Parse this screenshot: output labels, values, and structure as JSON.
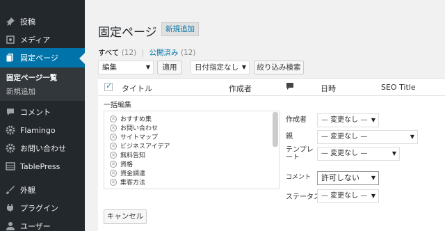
{
  "sidebar": {
    "items": [
      {
        "label": "投稿",
        "icon": "pin-icon"
      },
      {
        "label": "メディア",
        "icon": "media-icon"
      },
      {
        "label": "固定ページ",
        "icon": "pages-icon"
      },
      {
        "label": "コメント",
        "icon": "comment-icon"
      },
      {
        "label": "Flamingo",
        "icon": "gear-icon"
      },
      {
        "label": "お問い合わせ",
        "icon": "gear-icon"
      },
      {
        "label": "TablePress",
        "icon": "table-icon"
      },
      {
        "label": "外観",
        "icon": "brush-icon"
      },
      {
        "label": "プラグイン",
        "icon": "plugin-icon"
      },
      {
        "label": "ユーザー",
        "icon": "user-icon"
      }
    ],
    "submenu": [
      {
        "label": "固定ページ一覧"
      },
      {
        "label": "新規追加"
      }
    ]
  },
  "header": {
    "title": "固定ページ",
    "add_new": "新規追加"
  },
  "filters": {
    "all_label": "すべて",
    "all_count": "(12)",
    "sep": "|",
    "published_label": "公開済み",
    "published_count": "(12)"
  },
  "toolbar": {
    "bulk_action": "編集",
    "apply": "適用",
    "date_filter": "日付指定なし",
    "filter_button": "絞り込み検索"
  },
  "table": {
    "columns": [
      "タイトル",
      "作成者",
      "日時",
      "SEO Title"
    ]
  },
  "bulk_edit": {
    "title": "一括編集",
    "pages": [
      "おすすめ集",
      "お問い合わせ",
      "サイトマップ",
      "ビジネスアイデア",
      "無料告知",
      "資格",
      "資金調達",
      "集客方法"
    ],
    "fields": {
      "author_label": "作成者",
      "author_value": "— 変更なし —",
      "parent_label": "親",
      "parent_value": "— 変更なし —",
      "template_label": "テンプレート",
      "template_value": "— 変更なし —",
      "comment_label": "コメント",
      "comment_value": "許可しない",
      "status_label": "ステータス",
      "status_value": "— 変更なし —"
    },
    "cancel": "キャンセル"
  }
}
